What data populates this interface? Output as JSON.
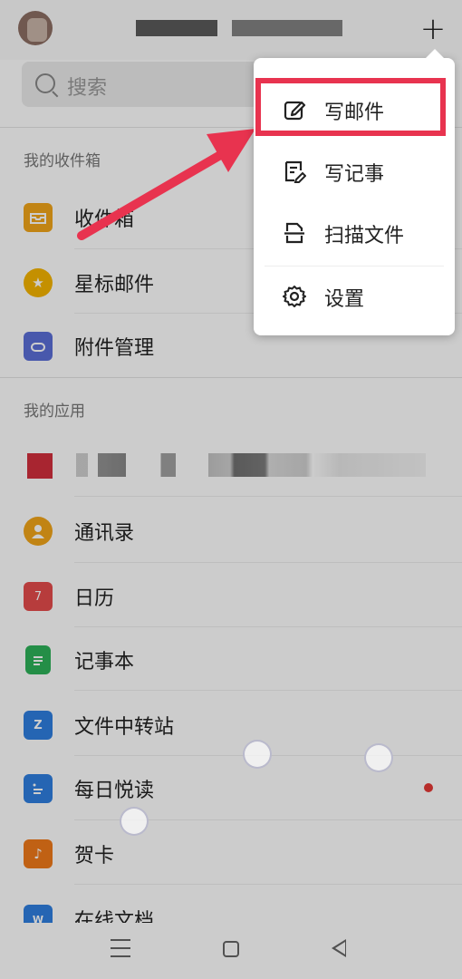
{
  "search": {
    "placeholder": "搜索"
  },
  "sections": {
    "mailbox_title": "我的收件箱",
    "apps_title": "我的应用"
  },
  "mailbox_items": [
    {
      "label": "收件箱",
      "icon": "inbox-icon",
      "color": "#f2a51a"
    },
    {
      "label": "星标邮件",
      "icon": "star-icon",
      "color": "#f5b400"
    },
    {
      "label": "附件管理",
      "icon": "attachment-icon",
      "color": "#5b6ed8"
    }
  ],
  "app_items": [
    {
      "label": "通讯录",
      "icon": "contacts-icon",
      "color": "#f2a51a"
    },
    {
      "label": "日历",
      "icon": "calendar-icon",
      "color": "#e54b4b",
      "badge": "7"
    },
    {
      "label": "记事本",
      "icon": "notepad-icon",
      "color": "#2db259"
    },
    {
      "label": "文件中转站",
      "icon": "folder-icon",
      "color": "#2f7fe0",
      "badge": "Z"
    },
    {
      "label": "每日悦读",
      "icon": "reading-icon",
      "color": "#2f7fe0"
    },
    {
      "label": "贺卡",
      "icon": "card-icon",
      "color": "#f07a1a"
    },
    {
      "label": "在线文档",
      "icon": "document-icon",
      "color": "#2f7fe0",
      "badge": "W"
    }
  ],
  "menu": {
    "items": [
      {
        "label": "写邮件",
        "icon": "compose-icon"
      },
      {
        "label": "写记事",
        "icon": "note-icon"
      },
      {
        "label": "扫描文件",
        "icon": "scan-icon"
      },
      {
        "label": "设置",
        "icon": "gear-icon"
      }
    ]
  },
  "colors": {
    "highlight": "#e8334f",
    "arrow": "#e8334f",
    "notification_dot": "#e53935"
  }
}
